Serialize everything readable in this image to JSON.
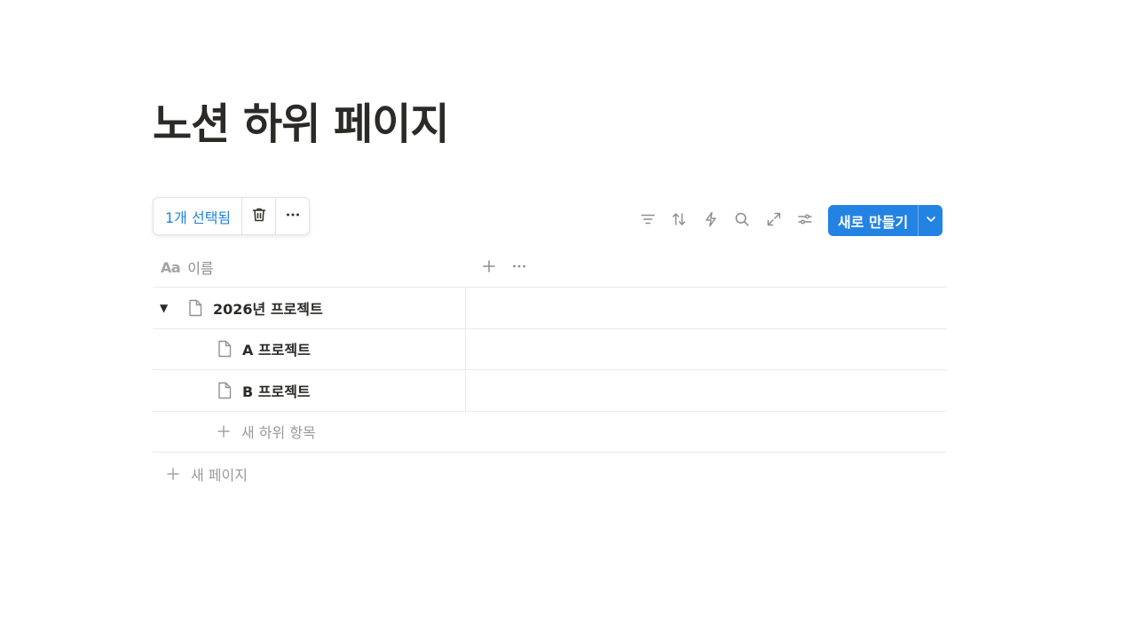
{
  "page": {
    "title": "노션 하위 페이지"
  },
  "selection": {
    "count_label": "1개 선택됨",
    "delete_icon": "trash-icon",
    "more_icon": "more-icon"
  },
  "toolbar": {
    "icons": [
      "filter-icon",
      "sort-icon",
      "automation-icon",
      "search-icon",
      "expand-icon",
      "settings-icon"
    ],
    "new_label": "새로 만들기",
    "accent_color": "#2383e2"
  },
  "table": {
    "column_header": "이름",
    "column_type_glyph": "Aa",
    "rows": [
      {
        "title": "2026년 프로젝트",
        "level": 0,
        "expanded": true
      },
      {
        "title": "A 프로젝트",
        "level": 1
      },
      {
        "title": "B 프로젝트",
        "level": 1
      }
    ],
    "add_subitem_label": "새 하위 항목",
    "add_page_label": "새 페이지"
  }
}
